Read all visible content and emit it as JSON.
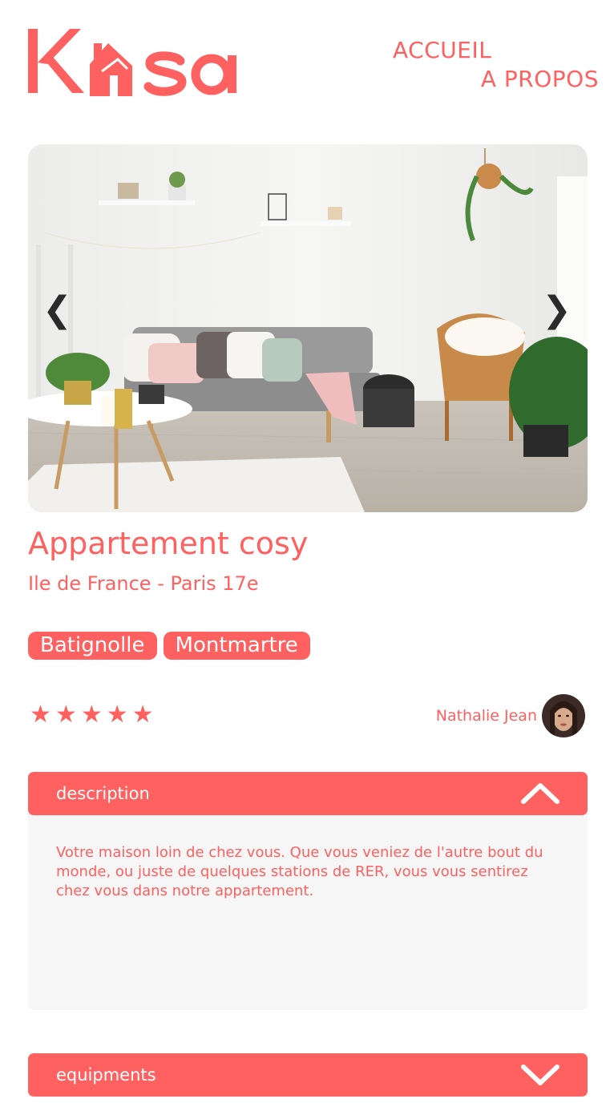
{
  "brand": {
    "name": "Kasa",
    "color": "#FF6060"
  },
  "nav": {
    "home": "ACCUEIL",
    "about": "A PROPOS"
  },
  "gallery": {
    "prev_icon": "chevron-left-icon",
    "next_icon": "chevron-right-icon",
    "prev_glyph": "❮",
    "next_glyph": "❯"
  },
  "listing": {
    "title": "Appartement cosy",
    "location": "Ile de France - Paris 17e",
    "tags": [
      "Batignolle",
      "Montmartre"
    ],
    "rating": 5,
    "rating_max": 5,
    "host": {
      "name": "Nathalie Jean"
    }
  },
  "collapses": {
    "description": {
      "title": "description",
      "text": "Votre maison loin de chez vous. Que vous veniez de l'autre bout du monde, ou juste de quelques stations de RER, vous vous sentirez chez vous dans notre appartement.",
      "icon": "chevron-up-icon"
    },
    "equipments": {
      "title": "equipments",
      "icon": "chevron-down-icon"
    }
  },
  "colors": {
    "accent": "#FF6060",
    "panel": "#F6F6F6"
  }
}
